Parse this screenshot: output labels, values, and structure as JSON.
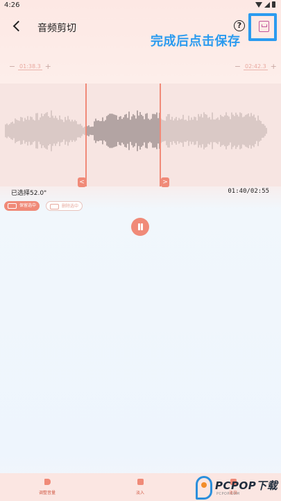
{
  "status_bar": {
    "time": "4:26"
  },
  "header": {
    "title": "音频剪切"
  },
  "annotation": "完成后点击保存",
  "trim": {
    "start_value": "01:38.3",
    "end_value": "02:42.3",
    "minus": "−",
    "plus": "+",
    "selected_label": "已选择52.0\"",
    "time_readout": "01:40/02:55",
    "handle_left": "<",
    "handle_right": ">",
    "selection_start_fraction": 0.305,
    "selection_end_fraction": 0.57
  },
  "modes": {
    "keep": "保留选中",
    "delete": "删除选中"
  },
  "tools": {
    "volume": "调整音量",
    "fadein": "淡入",
    "fadeout": "淡出"
  },
  "watermark": {
    "name": "PCPOP下载",
    "sub": "PCPOP.COM"
  },
  "colors": {
    "accent": "#f08a78",
    "highlight": "#2b9bef",
    "save_icon": "#c2569a"
  }
}
